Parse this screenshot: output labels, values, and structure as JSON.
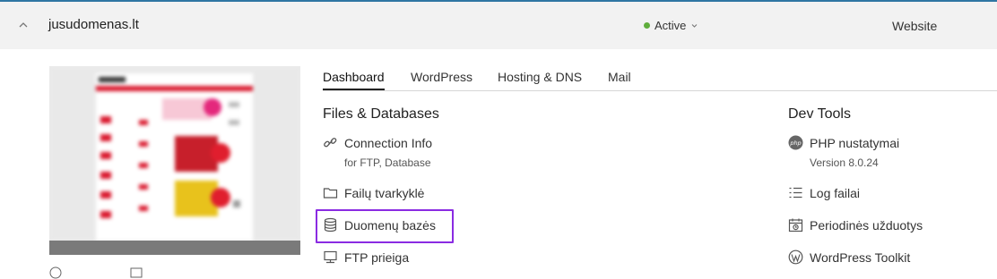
{
  "header": {
    "domain": "jusudomenas.lt",
    "status": "Active",
    "status_color": "#5fad3c",
    "website_label": "Website",
    "icons": {
      "collapse": "chevron-up-icon",
      "status_dropdown": "chevron-down-icon"
    }
  },
  "thumbnail": {
    "description_icon": "website-preview"
  },
  "tabs": [
    {
      "label": "Dashboard",
      "active": true
    },
    {
      "label": "WordPress",
      "active": false
    },
    {
      "label": "Hosting & DNS",
      "active": false
    },
    {
      "label": "Mail",
      "active": false
    }
  ],
  "files_databases": {
    "title": "Files & Databases",
    "items": [
      {
        "label": "Connection Info",
        "sub": "for FTP, Database",
        "icon": "link-icon"
      },
      {
        "label": "Failų tvarkyklė",
        "icon": "folder-icon"
      },
      {
        "label": "Duomenų bazės",
        "icon": "database-icon",
        "highlighted": true
      },
      {
        "label": "FTP prieiga",
        "icon": "monitor-icon"
      }
    ]
  },
  "dev_tools": {
    "title": "Dev Tools",
    "items": [
      {
        "label": "PHP nustatymai",
        "sub": "Version 8.0.24",
        "icon": "php-icon"
      },
      {
        "label": "Log failai",
        "icon": "list-icon"
      },
      {
        "label": "Periodinės užduotys",
        "icon": "calendar-icon"
      },
      {
        "label": "WordPress Toolkit",
        "icon": "wordpress-icon"
      }
    ]
  },
  "highlight_color": "#8a2be2"
}
